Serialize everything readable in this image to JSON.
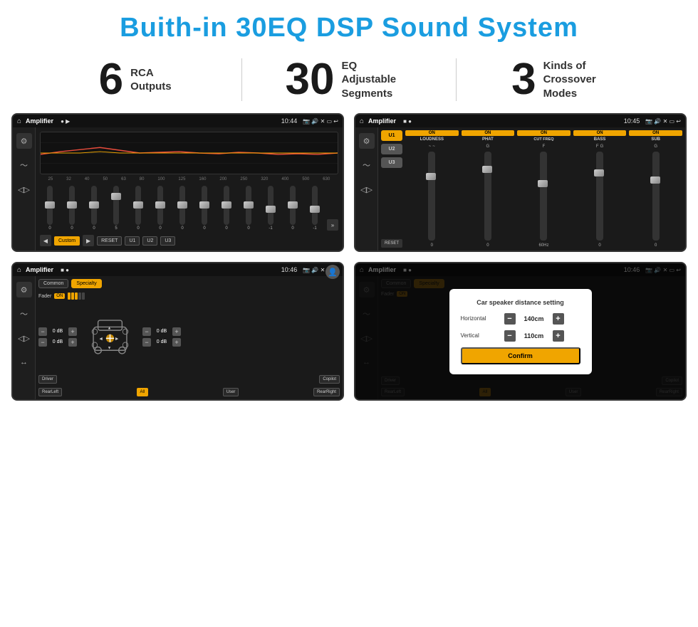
{
  "page": {
    "title": "Buith-in 30EQ DSP Sound System",
    "stats": [
      {
        "number": "6",
        "desc": "RCA\nOutputs"
      },
      {
        "number": "30",
        "desc": "EQ Adjustable\nSegments"
      },
      {
        "number": "3",
        "desc": "Kinds of\nCrossover Modes"
      }
    ],
    "screens": [
      {
        "id": "eq-screen",
        "title": "Amplifier",
        "time": "10:44",
        "type": "eq"
      },
      {
        "id": "dsp-screen",
        "title": "Amplifier",
        "time": "10:45",
        "type": "dsp"
      },
      {
        "id": "balance-screen",
        "title": "Amplifier",
        "time": "10:46",
        "type": "balance"
      },
      {
        "id": "distance-screen",
        "title": "Amplifier",
        "time": "10:46",
        "type": "distance"
      }
    ],
    "eq": {
      "freqs": [
        "25",
        "32",
        "40",
        "50",
        "63",
        "80",
        "100",
        "125",
        "160",
        "200",
        "250",
        "320",
        "400",
        "500",
        "630"
      ],
      "values": [
        "0",
        "0",
        "0",
        "5",
        "0",
        "0",
        "0",
        "0",
        "0",
        "0",
        "-1",
        "0",
        "-1"
      ],
      "preset": "Custom",
      "buttons": [
        "RESET",
        "U1",
        "U2",
        "U3"
      ]
    },
    "dsp": {
      "presets": [
        "U1",
        "U2",
        "U3"
      ],
      "channels": [
        {
          "label": "LOUDNESS",
          "on": true
        },
        {
          "label": "PHAT",
          "on": true
        },
        {
          "label": "CUT FREQ",
          "on": true
        },
        {
          "label": "BASS",
          "on": true
        },
        {
          "label": "SUB",
          "on": true
        }
      ]
    },
    "balance": {
      "tabs": [
        "Common",
        "Specialty"
      ],
      "fader_label": "Fader",
      "fader_on": true,
      "db_rows": [
        "0 dB",
        "0 dB",
        "0 dB",
        "0 dB"
      ],
      "buttons": [
        "Driver",
        "Copilot",
        "RearLeft",
        "All",
        "User",
        "RearRight"
      ]
    },
    "distance": {
      "dialog_title": "Car speaker distance setting",
      "horizontal_label": "Horizontal",
      "horizontal_value": "140cm",
      "vertical_label": "Vertical",
      "vertical_value": "110cm",
      "confirm_label": "Confirm"
    }
  }
}
